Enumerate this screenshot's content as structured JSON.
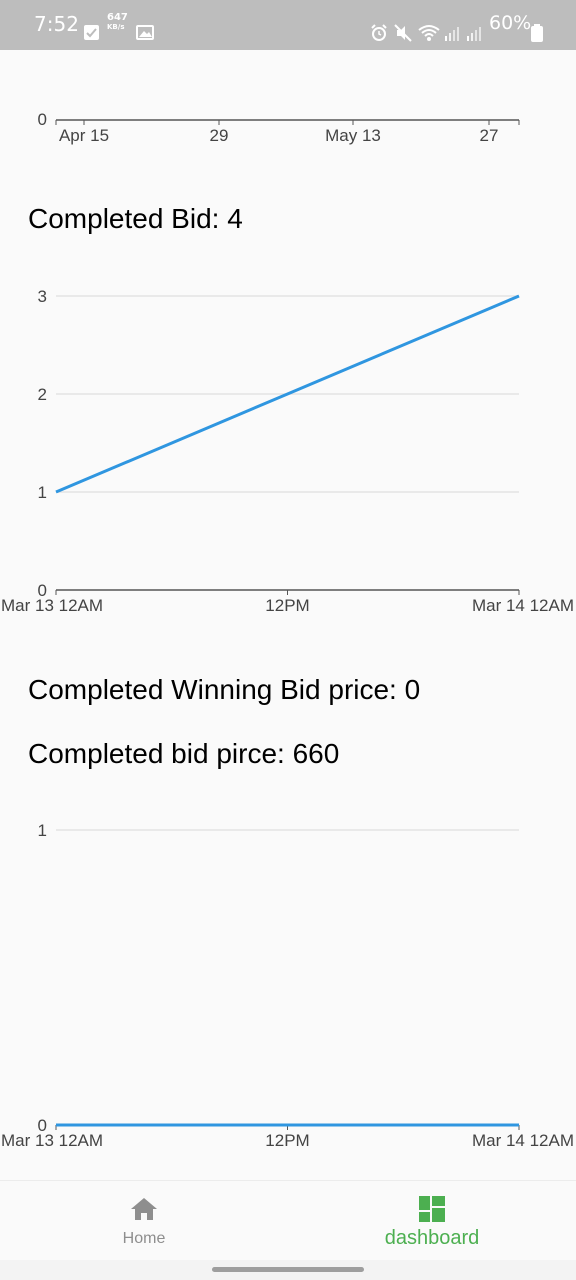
{
  "status_bar": {
    "time": "7:52",
    "net_speed": "647",
    "net_unit": "KB/s",
    "battery": "60%"
  },
  "top_chart": {
    "y_tick": "0",
    "x_ticks": [
      "Apr 15",
      "29",
      "May 13",
      "27"
    ]
  },
  "completed_bid": {
    "title": "Completed Bid: 4"
  },
  "completed_winning_bid_price": {
    "title": "Completed Winning Bid price: 0"
  },
  "completed_bid_price": {
    "title": "Completed bid pirce: 660"
  },
  "nav": {
    "home_label": "Home",
    "dashboard_label": "dashboard",
    "active_color": "#4caf50",
    "inactive_color": "#8e8e8e"
  },
  "chart_data": [
    {
      "type": "line",
      "title": "",
      "x": [
        "Apr 15",
        "29",
        "May 13",
        "27"
      ],
      "series": [
        {
          "values": [
            0,
            0,
            0,
            0
          ]
        }
      ],
      "y_ticks": [
        0
      ],
      "grid": true
    },
    {
      "type": "line",
      "title": "",
      "x": [
        "Mar 13 12AM",
        "12PM",
        "Mar 14 12AM"
      ],
      "series": [
        {
          "values": [
            1,
            2,
            3
          ]
        }
      ],
      "ylim": [
        0,
        3
      ],
      "y_ticks": [
        0,
        1,
        2,
        3
      ],
      "grid": true,
      "color": "#2f96e0"
    },
    {
      "type": "line",
      "title": "",
      "x": [
        "Mar 13 12AM",
        "12PM",
        "Mar 14 12AM"
      ],
      "series": [
        {
          "values": [
            0,
            0,
            0
          ]
        }
      ],
      "ylim": [
        0,
        1
      ],
      "y_ticks": [
        0,
        1
      ],
      "grid": true,
      "color": "#2f96e0"
    }
  ]
}
